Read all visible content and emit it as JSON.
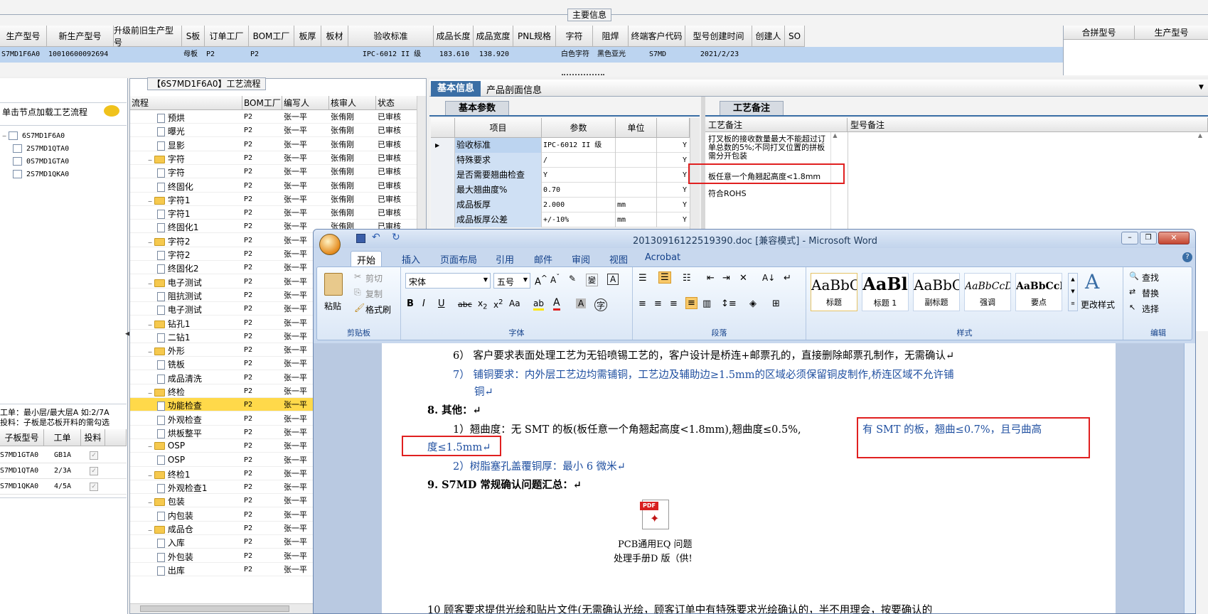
{
  "top": {
    "group_title": "主要信息",
    "columns": [
      "生产型号",
      "新生产型号",
      "升级前旧生产型号",
      "S板",
      "订单工厂",
      "BOM工厂",
      "板厚",
      "板材",
      "验收标准",
      "成品长度",
      "成品宽度",
      "PNL规格",
      "字符",
      "阻焊",
      "终端客户代码",
      "型号创建时间",
      "创建人",
      "SO"
    ],
    "row": [
      "S7MD1F6A0",
      "10010600092694",
      "",
      "母板",
      "P2",
      "P2",
      "",
      "",
      "IPC-6012 II 级",
      "183.610",
      "138.920",
      "",
      "白色字符",
      "黑色亚光",
      "S7MD",
      "2021/2/23",
      "",
      ""
    ],
    "right_cols": [
      "合拼型号",
      "生产型号"
    ]
  },
  "left": {
    "hint": "单击节点加载工艺流程",
    "tree": [
      "6S7MD1F6A0",
      "2S7MD1QTA0",
      "0S7MD1GTA0",
      "2S7MD1QKA0"
    ],
    "note1": "工单：最小层/最大层A 如:2/7A",
    "note2": "投料：子板是芯板开料的需勾选",
    "sub_cols": [
      "子板型号",
      "工单",
      "投料"
    ],
    "sub_rows": [
      [
        "S7MD1GTA0",
        "GB1A"
      ],
      [
        "S7MD1QTA0",
        "2/3A"
      ],
      [
        "S7MD1QKA0",
        "4/5A"
      ]
    ]
  },
  "flow": {
    "title": "【6S7MD1F6A0】工艺流程",
    "cols": [
      "流程",
      "BOM工厂",
      "编写人",
      "核审人",
      "状态"
    ],
    "rows": [
      {
        "lvl": 2,
        "name": "预烘",
        "f": "P2",
        "w": "张一平",
        "r": "张侑刚",
        "s": "已审核"
      },
      {
        "lvl": 2,
        "name": "曝光",
        "f": "P2",
        "w": "张一平",
        "r": "张侑刚",
        "s": "已审核"
      },
      {
        "lvl": 2,
        "name": "显影",
        "f": "P2",
        "w": "张一平",
        "r": "张侑刚",
        "s": "已审核"
      },
      {
        "lvl": 1,
        "name": "字符",
        "f": "P2",
        "w": "张一平",
        "r": "张侑刚",
        "s": "已审核"
      },
      {
        "lvl": 2,
        "name": "字符",
        "f": "P2",
        "w": "张一平",
        "r": "张侑刚",
        "s": "已审核"
      },
      {
        "lvl": 2,
        "name": "终固化",
        "f": "P2",
        "w": "张一平",
        "r": "张侑刚",
        "s": "已审核"
      },
      {
        "lvl": 1,
        "name": "字符1",
        "f": "P2",
        "w": "张一平",
        "r": "张侑刚",
        "s": "已审核"
      },
      {
        "lvl": 2,
        "name": "字符1",
        "f": "P2",
        "w": "张一平",
        "r": "张侑刚",
        "s": "已审核"
      },
      {
        "lvl": 2,
        "name": "终固化1",
        "f": "P2",
        "w": "张一平",
        "r": "张侑刚",
        "s": "已审核"
      },
      {
        "lvl": 1,
        "name": "字符2",
        "f": "P2",
        "w": "张一平",
        "r": "",
        "s": ""
      },
      {
        "lvl": 2,
        "name": "字符2",
        "f": "P2",
        "w": "张一平",
        "r": "",
        "s": ""
      },
      {
        "lvl": 2,
        "name": "终固化2",
        "f": "P2",
        "w": "张一平",
        "r": "",
        "s": ""
      },
      {
        "lvl": 1,
        "name": "电子测试",
        "f": "P2",
        "w": "张一平",
        "r": "",
        "s": ""
      },
      {
        "lvl": 2,
        "name": "阻抗测试",
        "f": "P2",
        "w": "张一平",
        "r": "",
        "s": ""
      },
      {
        "lvl": 2,
        "name": "电子测试",
        "f": "P2",
        "w": "张一平",
        "r": "",
        "s": ""
      },
      {
        "lvl": 1,
        "name": "钻孔1",
        "f": "P2",
        "w": "张一平",
        "r": "",
        "s": ""
      },
      {
        "lvl": 2,
        "name": "二钻1",
        "f": "P2",
        "w": "张一平",
        "r": "",
        "s": ""
      },
      {
        "lvl": 1,
        "name": "外形",
        "f": "P2",
        "w": "张一平",
        "r": "",
        "s": ""
      },
      {
        "lvl": 2,
        "name": "铣板",
        "f": "P2",
        "w": "张一平",
        "r": "",
        "s": ""
      },
      {
        "lvl": 2,
        "name": "成品清洗",
        "f": "P2",
        "w": "张一平",
        "r": "",
        "s": ""
      },
      {
        "lvl": 1,
        "name": "终检",
        "f": "P2",
        "w": "张一平",
        "r": "",
        "s": ""
      },
      {
        "lvl": 2,
        "name": "功能检查",
        "f": "P2",
        "w": "张一平",
        "r": "",
        "s": "",
        "sel": true
      },
      {
        "lvl": 2,
        "name": "外观检查",
        "f": "P2",
        "w": "张一平",
        "r": "",
        "s": ""
      },
      {
        "lvl": 2,
        "name": "烘板整平",
        "f": "P2",
        "w": "张一平",
        "r": "",
        "s": ""
      },
      {
        "lvl": 1,
        "name": "OSP",
        "f": "P2",
        "w": "张一平",
        "r": "",
        "s": ""
      },
      {
        "lvl": 2,
        "name": "OSP",
        "f": "P2",
        "w": "张一平",
        "r": "",
        "s": ""
      },
      {
        "lvl": 1,
        "name": "终检1",
        "f": "P2",
        "w": "张一平",
        "r": "",
        "s": ""
      },
      {
        "lvl": 2,
        "name": "外观检查1",
        "f": "P2",
        "w": "张一平",
        "r": "",
        "s": ""
      },
      {
        "lvl": 1,
        "name": "包装",
        "f": "P2",
        "w": "张一平",
        "r": "",
        "s": ""
      },
      {
        "lvl": 2,
        "name": "内包装",
        "f": "P2",
        "w": "张一平",
        "r": "",
        "s": ""
      },
      {
        "lvl": 1,
        "name": "成品仓",
        "f": "P2",
        "w": "张一平",
        "r": "",
        "s": ""
      },
      {
        "lvl": 2,
        "name": "入库",
        "f": "P2",
        "w": "张一平",
        "r": "",
        "s": ""
      },
      {
        "lvl": 2,
        "name": "外包装",
        "f": "P2",
        "w": "张一平",
        "r": "",
        "s": ""
      },
      {
        "lvl": 2,
        "name": "出库",
        "f": "P2",
        "w": "张一平",
        "r": "",
        "s": ""
      }
    ]
  },
  "info": {
    "tab1": "基本信息",
    "tab2": "产品剖面信息",
    "sub": "基本参数",
    "cols": [
      "项目",
      "参数",
      "单位"
    ],
    "rows": [
      [
        "验收标准",
        "IPC-6012 II 级",
        "",
        "Y"
      ],
      [
        "特殊要求",
        "/",
        "",
        "Y"
      ],
      [
        "是否需要翘曲检查",
        "Y",
        "",
        "Y"
      ],
      [
        "最大翘曲度%",
        "0.70",
        "",
        "Y"
      ],
      [
        "成品板厚",
        "2.000",
        "mm",
        "Y"
      ],
      [
        "成品板厚公差",
        "+/-10%",
        "mm",
        "Y"
      ]
    ]
  },
  "remarks": {
    "tab": "工艺备注",
    "col1": "工艺备注",
    "col2": "型号备注",
    "line1": "打叉板的接收数量最大不能超过订单总数的5%;不同打叉位置的拼板需分开包装",
    "line2": "板任意一个角翘起高度<1.8mm",
    "line3": "符合ROHS"
  },
  "word": {
    "title": "20130916122519390.doc [兼容模式] - Microsoft Word",
    "tabs": [
      "开始",
      "插入",
      "页面布局",
      "引用",
      "邮件",
      "审阅",
      "视图",
      "Acrobat"
    ],
    "paste": "粘贴",
    "cut": "剪切",
    "copy": "复制",
    "painter": "格式刷",
    "clip_grp": "剪贴板",
    "font": "宋体",
    "size": "五号",
    "font_grp": "字体",
    "para_grp": "段落",
    "styles": [
      {
        "s": "AaBbC",
        "l": "标题"
      },
      {
        "s": "AaBl",
        "l": "标题 1"
      },
      {
        "s": "AaBbC",
        "l": "副标题"
      },
      {
        "s": "AaBbCcD",
        "l": "强调"
      },
      {
        "s": "AaBbCcD",
        "l": "要点"
      }
    ],
    "change_style": "更改样式",
    "style_grp": "样式",
    "find": "查找",
    "replace": "替换",
    "select": "选择",
    "edit_grp": "编辑",
    "doc": {
      "p6": "6） 客户要求表面处理工艺为无铅喷锡工艺的，客户设计是桥连+邮票孔的，直接删除邮票孔制作，无需确认↵",
      "p7a": "7） 铺铜要求：内外层工艺边均需铺铜，工艺边及辅助边≥1.5mm的区域必须保留铜皮制作,桥连区域不允许铺",
      "p7b": "铜↵",
      "h8": "8.   其他：↵",
      "p1a": "1）翘曲度：无 SMT 的板(板任意一个角翘起高度<1.8mm),翘曲度≤0.5%,",
      "p1b": "有 SMT 的板，翘曲≤0.7%，且弓曲高",
      "p1c": "度≤1.5mm↵",
      "p2": "2）树脂塞孔盖覆铜厚：最小 6 微米↵",
      "h9": "9.   S7MD 常规确认问题汇总：↵",
      "pdf1": "PCB通用EQ 问题",
      "pdf2": "处理手册D 版（供!",
      "p10": "10  顾客要求提供光绘和贴片文件(无需确认光绘，顾客订单中有特殊要求光绘确认的，半不用理会，按要确认的"
    },
    "colors": {
      "accent": "#3a6ea5",
      "word_blue": "#1f4fa0",
      "red": "#e02020"
    }
  }
}
